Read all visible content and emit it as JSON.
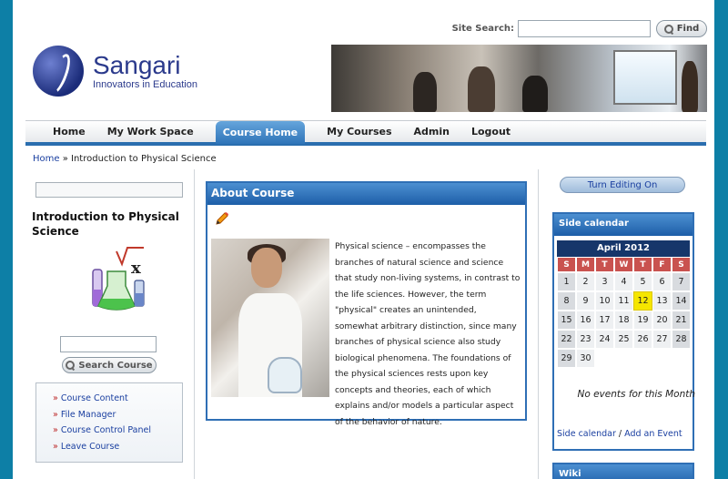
{
  "header": {
    "search_label": "Site Search:",
    "find_label": "Find",
    "logo_name": "Sangari",
    "logo_tagline": "Innovators in Education"
  },
  "nav": {
    "items": [
      "Home",
      "My Work Space",
      "Course Home",
      "My Courses",
      "Admin",
      "Logout"
    ],
    "active": "Course Home"
  },
  "breadcrumb": {
    "home": "Home",
    "separator": " » ",
    "current": "Introduction to Physical Science"
  },
  "left": {
    "course_title": "Introduction to Physical Science",
    "search_button": "Search Course",
    "links": [
      "Course Content",
      "File Manager",
      "Course Control Panel",
      "Leave Course"
    ]
  },
  "about": {
    "title": "About Course",
    "text": "Physical science – encompasses the branches of natural science and science that study non-living systems, in contrast to the life sciences. However, the term \"physical\" creates an unintended, somewhat arbitrary distinction, since many branches of physical science also study biological phenomena. The foundations of the physical sciences rests upon key concepts and theories, each of which explains and/or models a particular aspect of the behavior of nature."
  },
  "right": {
    "editing_button": "Turn Editing On",
    "calendar_title": "Side calendar",
    "month": "April 2012",
    "day_headers": [
      "S",
      "M",
      "T",
      "W",
      "T",
      "F",
      "S"
    ],
    "weeks": [
      [
        "1",
        "2",
        "3",
        "4",
        "5",
        "6",
        "7"
      ],
      [
        "8",
        "9",
        "10",
        "11",
        "12",
        "13",
        "14"
      ],
      [
        "15",
        "16",
        "17",
        "18",
        "19",
        "20",
        "21"
      ],
      [
        "22",
        "23",
        "24",
        "25",
        "26",
        "27",
        "28"
      ],
      [
        "29",
        "30",
        "",
        "",
        "",
        "",
        ""
      ]
    ],
    "today": "12",
    "no_events": "No events for this Month",
    "link_calendar": "Side calendar",
    "link_separator": " / ",
    "link_add_event": "Add an Event",
    "wiki_title": "Wiki"
  }
}
